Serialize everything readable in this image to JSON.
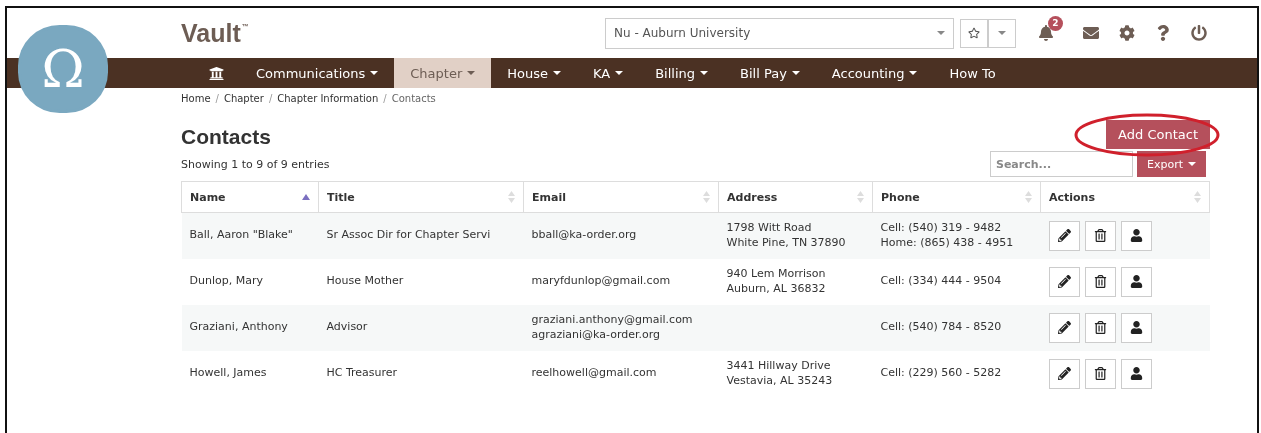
{
  "logo": {
    "symbol": "Ω"
  },
  "brand": {
    "name": "Vault",
    "mark": "™"
  },
  "chapter_select": {
    "value": "Nu - Auburn University"
  },
  "notifications": {
    "count": "2"
  },
  "nav": [
    {
      "label": "Communications",
      "has_menu": true,
      "selected": false
    },
    {
      "label": "Chapter",
      "has_menu": true,
      "selected": true
    },
    {
      "label": "House",
      "has_menu": true,
      "selected": false
    },
    {
      "label": "KA",
      "has_menu": true,
      "selected": false
    },
    {
      "label": "Billing",
      "has_menu": true,
      "selected": false
    },
    {
      "label": "Bill Pay",
      "has_menu": true,
      "selected": false
    },
    {
      "label": "Accounting",
      "has_menu": true,
      "selected": false
    },
    {
      "label": "How To",
      "has_menu": false,
      "selected": false
    }
  ],
  "breadcrumb": [
    {
      "kind": "link",
      "text": "Home"
    },
    {
      "kind": "separator",
      "text": "/"
    },
    {
      "kind": "link",
      "text": "Chapter"
    },
    {
      "kind": "separator",
      "text": "/"
    },
    {
      "kind": "link",
      "text": "Chapter Information"
    },
    {
      "kind": "separator",
      "text": "/"
    },
    {
      "kind": "current",
      "text": "Contacts"
    }
  ],
  "title": "Contacts",
  "add_button": "Add Contact",
  "entries_info": "Showing 1 to 9 of 9 entries",
  "search": {
    "placeholder": "Search..."
  },
  "export_button": "Export",
  "table": {
    "columns": [
      {
        "label": "Name",
        "sorted": true
      },
      {
        "label": "Title",
        "sorted": false
      },
      {
        "label": "Email",
        "sorted": false
      },
      {
        "label": "Address",
        "sorted": false
      },
      {
        "label": "Phone",
        "sorted": false
      },
      {
        "label": "Actions",
        "sorted": false
      }
    ],
    "rows": [
      {
        "name": "Ball, Aaron \"Blake\"",
        "title": "Sr Assoc Dir for Chapter Servi",
        "email": [
          "bball@ka-order.org"
        ],
        "address": [
          "1798 Witt Road",
          "White Pine, TN 37890"
        ],
        "phone": [
          "Cell: (540) 319 - 9482",
          "Home: (865) 438 - 4951"
        ]
      },
      {
        "name": "Dunlop, Mary",
        "title": "House Mother",
        "email": [
          "maryfdunlop@gmail.com"
        ],
        "address": [
          "940 Lem Morrison",
          "Auburn, AL 36832"
        ],
        "phone": [
          "Cell: (334) 444 - 9504"
        ]
      },
      {
        "name": "Graziani, Anthony",
        "title": "Advisor",
        "email": [
          "graziani.anthony@gmail.com",
          "agraziani@ka-order.org"
        ],
        "phone": [
          "Cell: (540) 784 - 8520"
        ]
      },
      {
        "name": "Howell, James",
        "title": "HC Treasurer",
        "email": [
          "reelhowell@gmail.com"
        ],
        "address": [
          "3441 Hillway Drive",
          "Vestavia, AL 35243"
        ],
        "phone": [
          "Cell: (229) 560 - 5282"
        ]
      }
    ]
  }
}
